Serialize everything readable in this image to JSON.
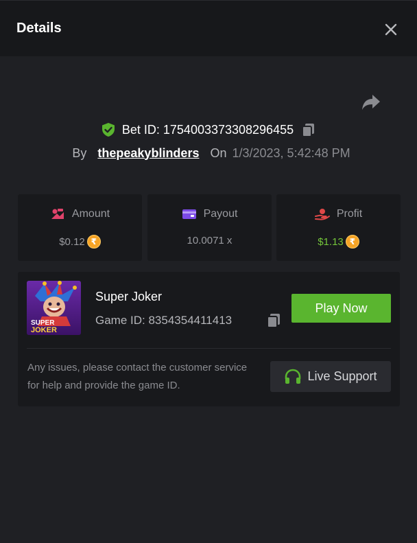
{
  "header": {
    "title": "Details"
  },
  "bet": {
    "id_label": "Bet ID: 1754003373308296455",
    "by_label": "By",
    "username": "thepeakyblinders",
    "on_label": "On",
    "datetime": "1/3/2023, 5:42:48 PM"
  },
  "stats": {
    "amount": {
      "label": "Amount",
      "value": "$0.12",
      "currency_symbol": "₹"
    },
    "payout": {
      "label": "Payout",
      "value": "10.0071 x"
    },
    "profit": {
      "label": "Profit",
      "value": "$1.13",
      "currency_symbol": "₹"
    }
  },
  "game": {
    "name": "Super Joker",
    "id_label": "Game ID: 8354354411413",
    "thumbnail_text_line1": "SUPER",
    "thumbnail_text_line2": "JOKER",
    "play_label": "Play Now"
  },
  "support": {
    "note": "Any issues, please contact the customer service for help and provide the game ID.",
    "button_label": "Live Support"
  },
  "colors": {
    "background": "#1f2024",
    "header_bg": "#17181b",
    "card_bg": "#18191c",
    "accent_green": "#5ab52f",
    "profit_green": "#74c53a",
    "coin_orange": "#f6a426",
    "amount_icon": "#e0436b",
    "payout_icon": "#7b4ae6",
    "profit_icon": "#e04848"
  },
  "icons": {
    "close": "close-icon",
    "share": "share-icon",
    "verified": "shield-check-icon",
    "copy": "copy-icon",
    "amount": "bet-chip-icon",
    "payout": "wallet-icon",
    "profit": "hand-coin-icon",
    "support": "headset-icon"
  }
}
